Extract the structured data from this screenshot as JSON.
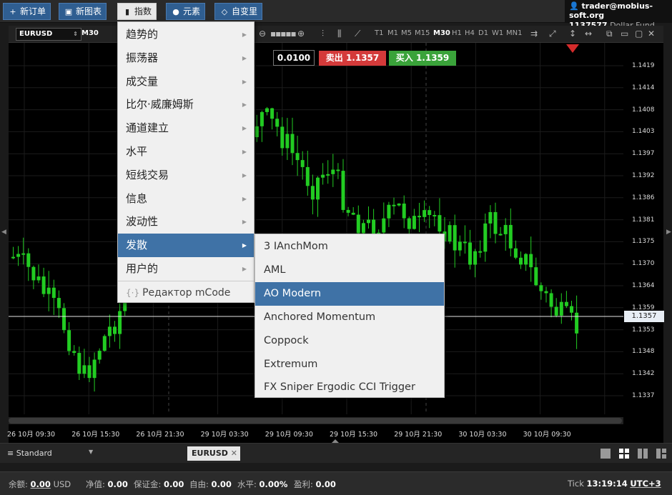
{
  "toolbar": {
    "new_order": "新订单",
    "new_chart": "新图表",
    "indicators": "指数",
    "elements": "元素",
    "custom_vars": "自变里"
  },
  "account": {
    "email": "trader@mobius-soft.org",
    "number": "1137577",
    "type": "Dollar Fund"
  },
  "chart_toolbar": {
    "symbol": "EURUSD",
    "timeframe": "M30",
    "timeframes": [
      "T1",
      "M1",
      "M5",
      "M15",
      "M30",
      "H1",
      "H4",
      "D1",
      "W1",
      "MN1"
    ],
    "selected_timeframe": "M30"
  },
  "trade": {
    "lot": "0.0100",
    "sell_label": "卖出",
    "sell_price": "1.1357",
    "buy_label": "买入",
    "buy_price": "1.1359"
  },
  "indicator_menu": {
    "items": [
      {
        "label": "趋势的"
      },
      {
        "label": "振荡器"
      },
      {
        "label": "成交量"
      },
      {
        "label": "比尔·威廉姆斯"
      },
      {
        "label": "通道建立"
      },
      {
        "label": "水平"
      },
      {
        "label": "短线交易"
      },
      {
        "label": "信息"
      },
      {
        "label": "波动性"
      },
      {
        "label": "发散"
      },
      {
        "label": "用户的"
      }
    ],
    "highlighted": "发散",
    "editor": "Редактор mCode"
  },
  "divergence_menu": {
    "items": [
      {
        "label": "3 IAnchMom"
      },
      {
        "label": "AML"
      },
      {
        "label": "AO Modern"
      },
      {
        "label": "Anchored Momentum"
      },
      {
        "label": "Coppock"
      },
      {
        "label": "Extremum"
      },
      {
        "label": "FX Sniper Ergodic CCI Trigger"
      }
    ],
    "highlighted": "AO Modern"
  },
  "price_axis": [
    "1.1419",
    "1.1414",
    "1.1408",
    "1.1403",
    "1.1397",
    "1.1392",
    "1.1386",
    "1.1381",
    "1.1375",
    "1.1370",
    "1.1364",
    "1.1359",
    "1.1353",
    "1.1348",
    "1.1342",
    "1.1337"
  ],
  "current_price": "1.1357",
  "time_axis": [
    "26 10月 09:30",
    "26 10月 15:30",
    "26 10月 21:30",
    "29 10月 03:30",
    "29 10月 09:30",
    "29 10月 15:30",
    "29 10月 21:30",
    "30 10月 03:30",
    "30 10月 09:30"
  ],
  "tabs": {
    "preset": "Standard",
    "symbol_tab": "EURUSD"
  },
  "status": {
    "balance_label": "余额:",
    "balance_value": "0.00",
    "currency": "USD",
    "equity_label": "净值:",
    "equity_value": "0.00",
    "margin_label": "保证金:",
    "margin_value": "0.00",
    "free_label": "自由:",
    "free_value": "0.00",
    "level_label": "水平:",
    "level_value": "0.00%",
    "profit_label": "盈利:",
    "profit_value": "0.00",
    "tick_label": "Tick",
    "time": "13:19:14",
    "tz": "UTC+3"
  },
  "colors": {
    "candle": "#22cc22",
    "sell": "#d43a3a",
    "buy": "#3aa33a",
    "menu_highlight": "#3f72a6"
  }
}
